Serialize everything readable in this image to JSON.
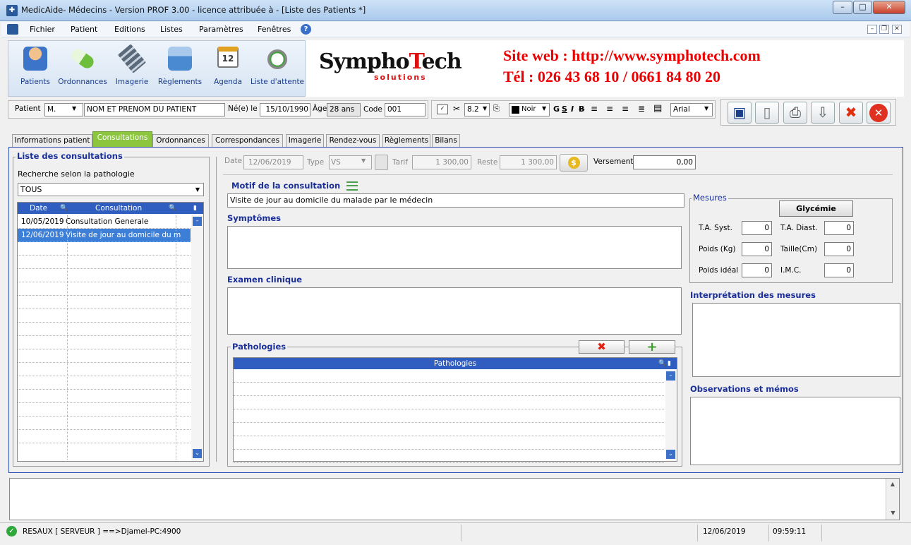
{
  "window": {
    "title": "MedicAide- Médecins - Version PROF 3.00 - licence attribuée à  - [Liste des Patients *]",
    "min": "–",
    "max": "□",
    "close": "✕"
  },
  "menu": [
    "Fichier",
    "Patient",
    "Editions",
    "Listes",
    "Paramètres",
    "Fenêtres"
  ],
  "mdi": {
    "min": "–",
    "restore": "❐",
    "close": "✕"
  },
  "toolbar": [
    {
      "label": "Patients",
      "icon": "patient-icon",
      "color": "#3b74c8"
    },
    {
      "label": "Ordonnances",
      "icon": "pill-icon",
      "color": "#6cbe3c"
    },
    {
      "label": "Imagerie",
      "icon": "film-icon",
      "color": "#5a6a7a"
    },
    {
      "label": "Règlements",
      "icon": "cash-register-icon",
      "color": "#4a8ad0"
    },
    {
      "label": "Agenda",
      "icon": "calendar-icon",
      "color": "#e0a020"
    },
    {
      "label": "Liste d'attente",
      "icon": "stopwatch-icon",
      "color": "#4aa04a"
    }
  ],
  "calendar_day": "12",
  "banner": {
    "logo_a": "Sympho",
    "logo_t": "T",
    "logo_b": "ech",
    "logo_sub": "solutions",
    "site": "Site web : http://www.symphotech.com",
    "tel": "Tél : 026 43 68 10 / 0661 84 80 20"
  },
  "patient": {
    "label": "Patient",
    "civ": "M.",
    "name": "NOM ET PRENOM DU PATIENT",
    "born_label": "Né(e) le",
    "born": "15/10/1990",
    "age_label": "Âge",
    "age": "28 ans",
    "code_label": "Code",
    "code": "001"
  },
  "format": {
    "size": "8.2",
    "color": "Noir",
    "bold": "G",
    "underline": "S",
    "italic": "I",
    "strike": "B",
    "font": "Arial"
  },
  "tabs": [
    "Informations patient",
    "Consultations",
    "Ordonnances",
    "Correspondances",
    "Imagerie",
    "Rendez-vous",
    "Règlements",
    "Bilans"
  ],
  "list": {
    "title": "Liste des consultations",
    "search_label": "Recherche selon la pathologie",
    "filter": "TOUS",
    "col_date": "Date",
    "col_consult": "Consultation",
    "rows": [
      {
        "date": "10/05/2019",
        "text": "Consultation Generale"
      },
      {
        "date": "12/06/2019",
        "text": "Visite de jour au domicile du m"
      }
    ]
  },
  "consult": {
    "date_label": "Date",
    "date": "12/06/2019",
    "type_label": "Type",
    "type": "VS",
    "tarif_label": "Tarif",
    "tarif": "1 300,00",
    "reste_label": "Reste",
    "reste": "1 300,00",
    "vers_label": "Versement",
    "vers": "0,00",
    "dollar": "$",
    "motif_label": "Motif de la consultation",
    "motif": "Visite de jour au domicile du malade par le médecin",
    "sympt_label": "Symptômes",
    "exam_label": "Examen clinique",
    "path_label": "Pathologies",
    "path_col": "Pathologies"
  },
  "mesures": {
    "title": "Mesures",
    "btn": "Glycémie",
    "tas": "T.A. Syst.",
    "tas_v": "0",
    "tad": "T.A. Diast.",
    "tad_v": "0",
    "poids": "Poids (Kg)",
    "poids_v": "0",
    "taille": "Taille(Cm)",
    "taille_v": "0",
    "pid": "Poids idéal",
    "pid_v": "0",
    "imc": "I.M.C.",
    "imc_v": "0"
  },
  "interp_label": "Interprétation des mesures",
  "obs_label": "Observations et mémos",
  "status": {
    "net": "RESAUX [ SERVEUR ] ==>Djamel-PC:4900",
    "date": "12/06/2019",
    "time": "09:59:11"
  }
}
